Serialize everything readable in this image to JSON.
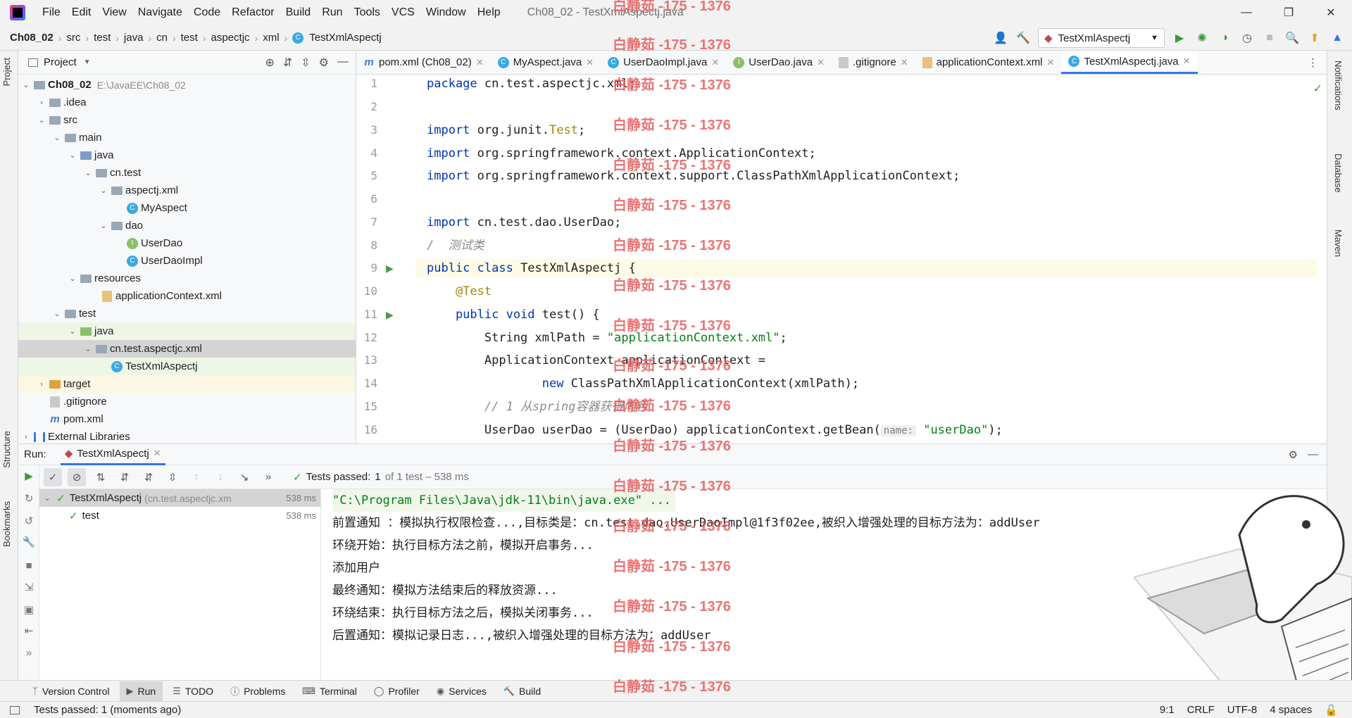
{
  "menubar": {
    "items": [
      "File",
      "Edit",
      "View",
      "Navigate",
      "Code",
      "Refactor",
      "Build",
      "Run",
      "Tools",
      "VCS",
      "Window",
      "Help"
    ],
    "window_title": "Ch08_02 - TestXmlAspectj.java"
  },
  "breadcrumb": [
    "Ch08_02",
    "src",
    "test",
    "java",
    "cn",
    "test",
    "aspectjc",
    "xml",
    "TestXmlAspectj"
  ],
  "run_config": "TestXmlAspectj",
  "project": {
    "title": "Project",
    "tree": [
      {
        "label": "Ch08_02",
        "path": "E:\\JavaEE\\Ch08_02"
      },
      {
        "label": ".idea"
      },
      {
        "label": "src"
      },
      {
        "label": "main"
      },
      {
        "label": "java"
      },
      {
        "label": "cn.test"
      },
      {
        "label": "aspectj.xml"
      },
      {
        "label": "MyAspect"
      },
      {
        "label": "dao"
      },
      {
        "label": "UserDao"
      },
      {
        "label": "UserDaoImpl"
      },
      {
        "label": "resources"
      },
      {
        "label": "applicationContext.xml"
      },
      {
        "label": "test"
      },
      {
        "label": "java"
      },
      {
        "label": "cn.test.aspectjc.xml"
      },
      {
        "label": "TestXmlAspectj"
      },
      {
        "label": "target"
      },
      {
        "label": ".gitignore"
      },
      {
        "label": "pom.xml"
      },
      {
        "label": "External Libraries"
      }
    ]
  },
  "tabs": [
    {
      "label": "pom.xml (Ch08_02)"
    },
    {
      "label": "MyAspect.java"
    },
    {
      "label": "UserDaoImpl.java"
    },
    {
      "label": "UserDao.java"
    },
    {
      "label": ".gitignore"
    },
    {
      "label": "applicationContext.xml"
    },
    {
      "label": "TestXmlAspectj.java"
    }
  ],
  "code": {
    "line_numbers": [
      "1",
      "2",
      "3",
      "4",
      "5",
      "6",
      "7",
      "8",
      "9",
      "10",
      "11",
      "12",
      "13",
      "14",
      "15",
      "16"
    ],
    "l1_kw": "package",
    "l1_rest": " cn.test.aspectjc.xml;",
    "l3_kw": "import",
    "l3_rest": " org.junit.",
    "l3_cls": "Test",
    "l3_end": ";",
    "l4_kw": "import",
    "l4_rest": " org.springframework.context.ApplicationContext;",
    "l5_kw": "import",
    "l5_rest": " org.springframework.context.support.ClassPathXmlApplicationContext;",
    "l7_kw": "import",
    "l7_rest": " cn.test.dao.UserDao;",
    "l8_comment": "/  测试类",
    "l9_kw": "public class",
    "l9_rest": " TestXmlAspectj {",
    "l10_ann": "    @Test",
    "l11_kw": "    public void",
    "l11_rest": " test() {",
    "l12_a": "        String xmlPath = ",
    "l12_str": "\"applicationContext.xml\"",
    "l12_end": ";",
    "l13": "        ApplicationContext applicationContext =",
    "l14_kw": "                new",
    "l14_rest": " ClassPathXmlApplicationContext(xmlPath);",
    "l15_comment": "        // 1 从spring容器获得内容",
    "l16_a": "        UserDao userDao = (UserDao) applicationContext.getBean(",
    "l16_hint": "name:",
    "l16_str": "\"userDao\"",
    "l16_end": ");"
  },
  "right_strip": [
    "Notifications",
    "Database",
    "Maven"
  ],
  "left_strip": [
    "Project",
    "Structure",
    "Bookmarks"
  ],
  "run": {
    "label": "Run:",
    "tab": "TestXmlAspectj",
    "tests_passed_label": "Tests passed:",
    "tests_passed_count": "1",
    "tests_passed_rest": "of 1 test – 538 ms",
    "tree": [
      {
        "label": "TestXmlAspectj",
        "detail": "(cn.test.aspectjc.xm",
        "time": "538 ms"
      },
      {
        "label": "test",
        "time": "538 ms"
      }
    ],
    "console": [
      "\"C:\\Program Files\\Java\\jdk-11\\bin\\java.exe\" ...",
      "前置通知 ：模拟执行权限检查...,目标类是：cn.test.dao.UserDaoImpl@1f3f02ee,被织入增强处理的目标方法为：addUser",
      "环绕开始：执行目标方法之前，模拟开启事务...",
      "添加用户",
      "最终通知：模拟方法结束后的释放资源...",
      "环绕结束：执行目标方法之后，模拟关闭事务...",
      "后置通知：模拟记录日志...,被织入增强处理的目标方法为：addUser"
    ]
  },
  "toolwindows": [
    "Version Control",
    "Run",
    "TODO",
    "Problems",
    "Terminal",
    "Profiler",
    "Services",
    "Build"
  ],
  "status": {
    "message": "Tests passed: 1 (moments ago)",
    "position": "9:1",
    "line_sep": "CRLF",
    "encoding": "UTF-8",
    "indent": "4 spaces"
  },
  "watermark": "白静茹 -175 - 1376",
  "colors": {
    "accent": "#3574f0",
    "keyword": "#0033b3",
    "string": "#067d17",
    "annotation": "#9e880d",
    "watermark": "#e85c5c"
  }
}
